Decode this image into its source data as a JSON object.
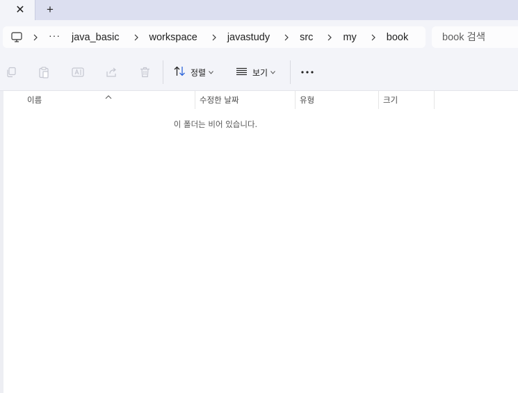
{
  "tabs": {
    "close_symbol": "✕",
    "new_tab_symbol": "+"
  },
  "breadcrumb": {
    "icon": "computer-icon",
    "more": "···",
    "segments": [
      "java_basic",
      "workspace",
      "javastudy",
      "src",
      "my",
      "book"
    ]
  },
  "search": {
    "placeholder": "book 검색"
  },
  "toolbar": {
    "sort_label": "정렬",
    "view_label": "보기",
    "disabled_icons": [
      "copy-icon",
      "paste-icon",
      "rename-icon",
      "share-icon",
      "delete-icon"
    ]
  },
  "columns": {
    "name": "이름",
    "modified": "수정한 날짜",
    "type": "유형",
    "size": "크기"
  },
  "empty_message": "이 폴더는 비어 있습니다.",
  "colors": {
    "tab_strip": "#dcdff0",
    "chrome": "#f3f4f9",
    "disabled_icon": "#c4c6d0"
  }
}
